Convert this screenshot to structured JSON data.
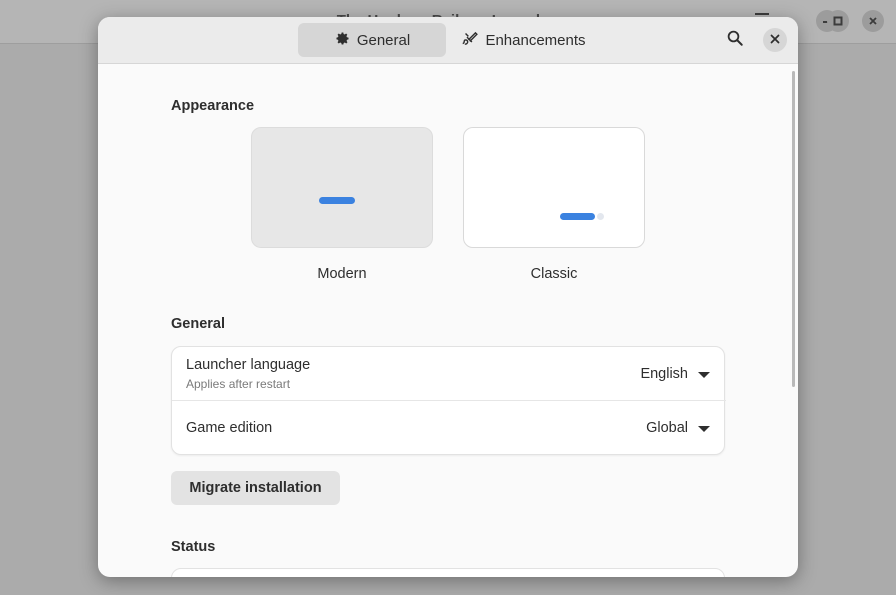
{
  "background_window": {
    "title": "The Honkers Railway Launcher"
  },
  "dialog": {
    "tabs": [
      {
        "label": "General",
        "icon": "gear-icon",
        "selected": true
      },
      {
        "label": "Enhancements",
        "icon": "brush-icon",
        "selected": false
      }
    ],
    "search_icon": "search-icon",
    "close_icon": "close-icon"
  },
  "appearance": {
    "title": "Appearance",
    "styles": [
      {
        "label": "Modern",
        "selected": true
      },
      {
        "label": "Classic",
        "selected": false
      }
    ]
  },
  "general": {
    "title": "General",
    "rows": [
      {
        "title": "Launcher language",
        "subtitle": "Applies after restart",
        "value": "English"
      },
      {
        "title": "Game edition",
        "value": "Global"
      }
    ],
    "migrate_label": "Migrate installation"
  },
  "status": {
    "title": "Status"
  },
  "colors": {
    "accent": "#3b82e0",
    "dialog_bg": "#fafafa",
    "header_bg": "#ebebeb"
  }
}
